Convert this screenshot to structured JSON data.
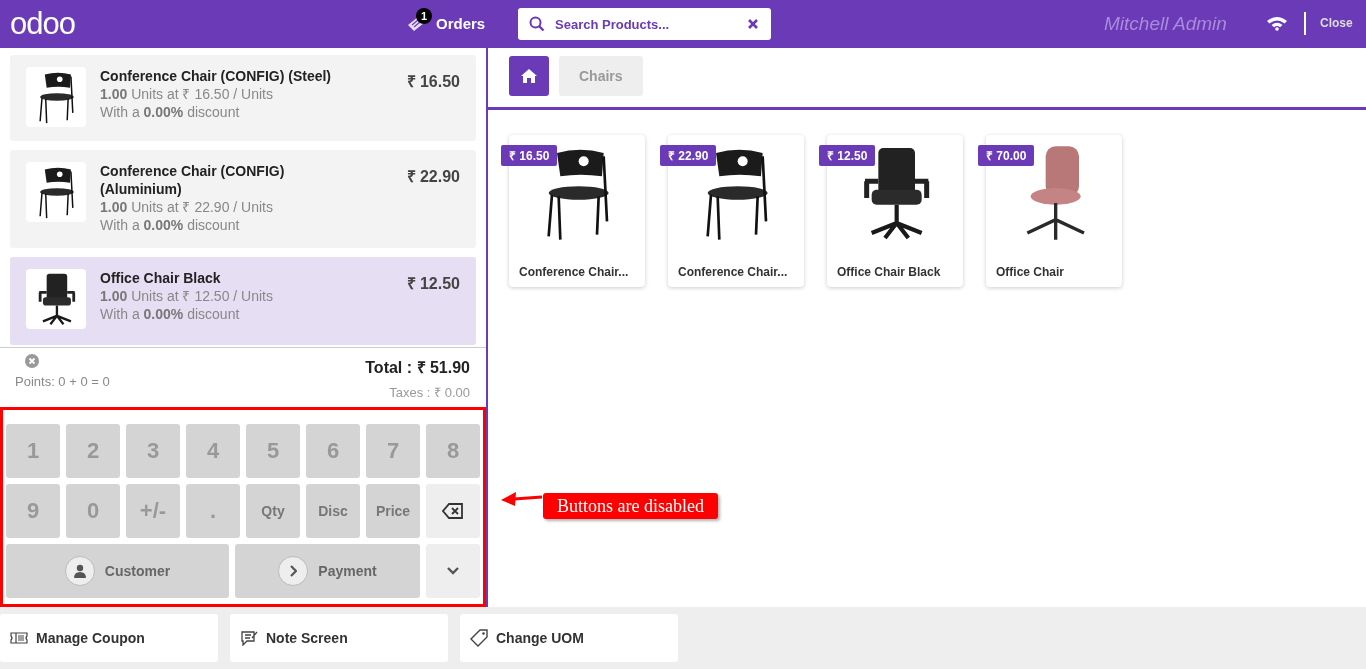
{
  "header": {
    "logo": "odoo",
    "orders": {
      "count": "1",
      "label": "Orders"
    },
    "search": {
      "placeholder": "Search Products..."
    },
    "user": "Mitchell Admin",
    "close": "Close"
  },
  "order_lines": [
    {
      "name": "Conference Chair (CONFIG) (Steel)",
      "price": "₹ 16.50",
      "detail": "**1.00** Units at ₹ 16.50 / Units",
      "discount": "With a **0.00%** discount",
      "kind": "stacking",
      "selected": false
    },
    {
      "name": "Conference Chair (CONFIG) (Aluminium)",
      "price": "₹ 22.90",
      "detail": "**1.00** Units at ₹ 22.90 / Units",
      "discount": "With a **0.00%** discount",
      "kind": "stacking",
      "selected": false
    },
    {
      "name": "Office Chair Black",
      "price": "₹ 12.50",
      "detail": "**1.00** Units at ₹ 12.50 / Units",
      "discount": "With a **0.00%** discount",
      "kind": "office",
      "selected": true
    }
  ],
  "summary": {
    "points": "Points: 0 + 0 = 0",
    "total": "Total : ₹ 51.90",
    "taxes": "Taxes : ₹ 0.00"
  },
  "numpad": {
    "keys": [
      {
        "label": "1",
        "kind": "digit",
        "disabled": true
      },
      {
        "label": "2",
        "kind": "digit",
        "disabled": true
      },
      {
        "label": "3",
        "kind": "digit",
        "disabled": true
      },
      {
        "label": "4",
        "kind": "digit",
        "disabled": true
      },
      {
        "label": "5",
        "kind": "digit",
        "disabled": true
      },
      {
        "label": "6",
        "kind": "digit",
        "disabled": true
      },
      {
        "label": "7",
        "kind": "digit",
        "disabled": true
      },
      {
        "label": "8",
        "kind": "digit",
        "disabled": true
      },
      {
        "label": "9",
        "kind": "digit",
        "disabled": true
      },
      {
        "label": "0",
        "kind": "digit",
        "disabled": true
      },
      {
        "label": "+/-",
        "kind": "digit",
        "disabled": true
      },
      {
        "label": ".",
        "kind": "digit",
        "disabled": true
      },
      {
        "label": "Qty",
        "kind": "mode",
        "disabled": true
      },
      {
        "label": "Disc",
        "kind": "mode",
        "disabled": true
      },
      {
        "label": "Price",
        "kind": "mode",
        "disabled": true
      },
      {
        "kind": "backspace",
        "disabled": false
      },
      {
        "label": "Customer",
        "kind": "customer",
        "disabled": true
      },
      {
        "label": "Payment",
        "kind": "payment",
        "disabled": true
      },
      {
        "kind": "more",
        "disabled": false
      }
    ]
  },
  "breadcrumb": {
    "category": "Chairs"
  },
  "products": [
    {
      "name": "Conference Chair...",
      "price": "₹ 16.50",
      "kind": "stacking"
    },
    {
      "name": "Conference Chair...",
      "price": "₹ 22.90",
      "kind": "stacking"
    },
    {
      "name": "Office Chair Black",
      "price": "₹ 12.50",
      "kind": "office"
    },
    {
      "name": "Office Chair",
      "price": "₹ 70.00",
      "kind": "swivel"
    }
  ],
  "control_buttons": [
    {
      "label": "Manage Coupon",
      "kind": "coupon"
    },
    {
      "label": "Note Screen",
      "kind": "note"
    },
    {
      "label": "Change UOM",
      "kind": "tag"
    }
  ],
  "annotation": {
    "label": "Buttons are disabled"
  }
}
